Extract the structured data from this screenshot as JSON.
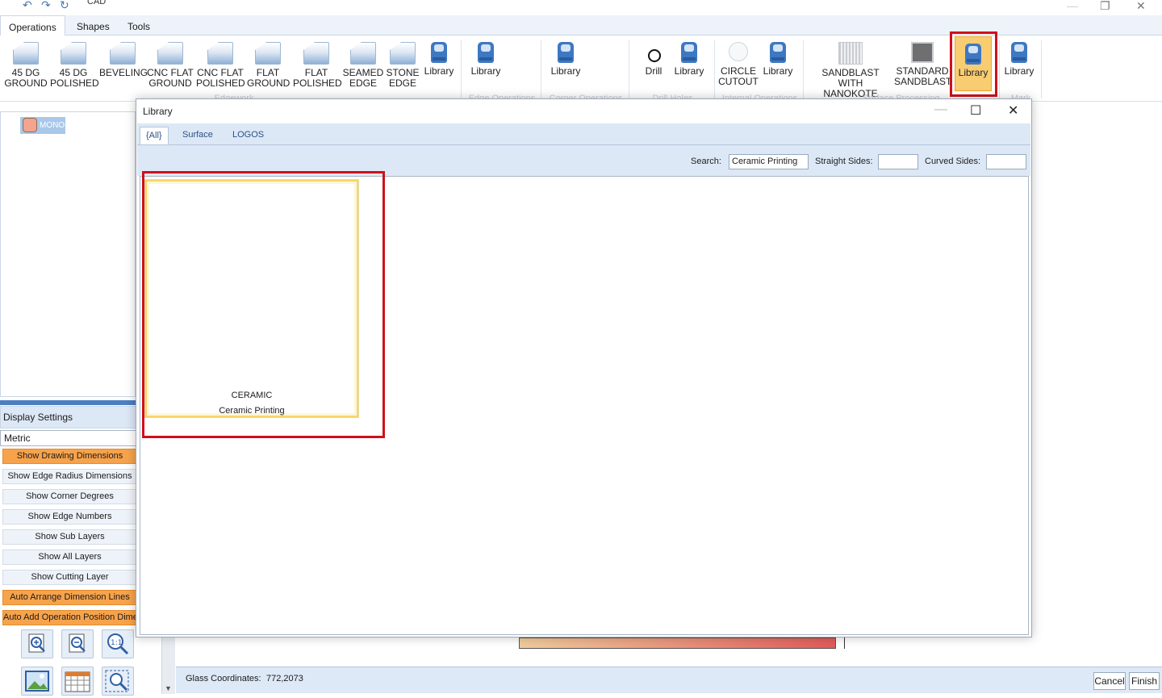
{
  "window": {
    "title": "CAD"
  },
  "ribbon": {
    "tabs": [
      "Operations",
      "Shapes",
      "Tools"
    ],
    "buttons": {
      "dg45_ground": [
        "45 DG",
        "GROUND"
      ],
      "dg45_polished": [
        "45 DG",
        "POLISHED"
      ],
      "beveling": "BEVELING",
      "cnc_flat_ground": [
        "CNC FLAT",
        "GROUND"
      ],
      "cnc_flat_polished": [
        "CNC FLAT",
        "POLISHED"
      ],
      "flat_ground": [
        "FLAT",
        "GROUND"
      ],
      "flat_polished": [
        "FLAT",
        "POLISHED"
      ],
      "seamed_edge": [
        "SEAMED",
        "EDGE"
      ],
      "stone_edge": [
        "STONE",
        "EDGE"
      ],
      "library": "Library",
      "drill": "Drill",
      "circle_cutout": [
        "CIRCLE",
        "CUTOUT"
      ],
      "sandblast_nanokote": [
        "SANDBLAST WITH",
        "NANOKOTE"
      ],
      "standard_sandblast": [
        "STANDARD",
        "SANDBLAST"
      ]
    },
    "groups": [
      "Edgework",
      "Edge Operations",
      "Corner Operations",
      "Drill Holes",
      "Internal Operations",
      "Surface Processing",
      "Mark"
    ]
  },
  "tree": {
    "item_label": "MONO",
    "swatch_color": "#f2a48e"
  },
  "display_settings": {
    "header": "Display Settings",
    "unit": "Metric",
    "options": [
      {
        "label": "Show Drawing Dimensions",
        "on": true
      },
      {
        "label": "Show Edge Radius Dimensions",
        "on": false
      },
      {
        "label": "Show Corner Degrees",
        "on": false
      },
      {
        "label": "Show Edge Numbers",
        "on": false
      },
      {
        "label": "Show Sub Layers",
        "on": false
      },
      {
        "label": "Show All Layers",
        "on": false
      },
      {
        "label": "Show Cutting Layer",
        "on": false
      },
      {
        "label": "Auto Arrange Dimension Lines",
        "on": true
      },
      {
        "label": "Auto Add Operation Position Dime",
        "on": true
      }
    ]
  },
  "dialog": {
    "title": "Library",
    "tabs": [
      "{All}",
      "Surface",
      "LOGOS"
    ],
    "search_label": "Search:",
    "search_value": "Ceramic Printing",
    "straight_sides_label": "Straight Sides:",
    "straight_sides_value": "",
    "curved_sides_label": "Curved Sides:",
    "curved_sides_value": "",
    "items": [
      {
        "title": "CERAMIC",
        "subtitle": "Ceramic Printing"
      }
    ]
  },
  "status": {
    "coords_label": "Glass Coordinates:",
    "coords_value": "772,2073",
    "cancel": "Cancel",
    "finish": "Finish"
  },
  "colors": {
    "accent_orange": "#f7a34b",
    "highlight_red": "#d0101a",
    "ribbon_blue": "#3d78c2"
  }
}
